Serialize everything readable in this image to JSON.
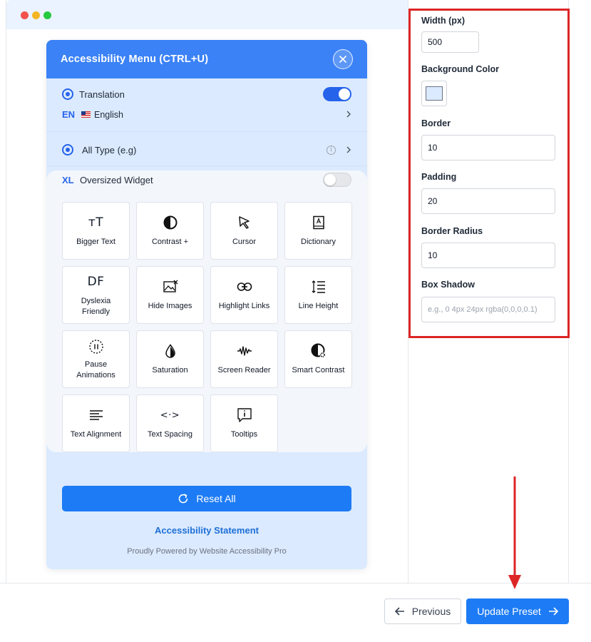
{
  "widget": {
    "title": "Accessibility Menu (CTRL+U)",
    "close_icon": "close-icon",
    "translation": {
      "label": "Translation",
      "enabled": true
    },
    "language": {
      "code": "EN",
      "name": "English",
      "flag_icon": "us-flag-icon"
    },
    "all_type": {
      "label": "All Type (e.g)"
    },
    "oversized": {
      "badge": "XL",
      "label": "Oversized Widget",
      "enabled": false
    },
    "tiles": [
      {
        "label": "Bigger Text",
        "icon": "bigger-text-icon",
        "glyph": "ᴛT"
      },
      {
        "label": "Contrast +",
        "icon": "contrast-icon"
      },
      {
        "label": "Cursor",
        "icon": "cursor-icon"
      },
      {
        "label": "Dictionary",
        "icon": "dictionary-icon"
      },
      {
        "label": "Dyslexia Friendly",
        "icon": "dyslexia-icon",
        "glyph": "DF"
      },
      {
        "label": "Hide Images",
        "icon": "hide-images-icon"
      },
      {
        "label": "Highlight Links",
        "icon": "link-icon"
      },
      {
        "label": "Line Height",
        "icon": "line-height-icon"
      },
      {
        "label": "Pause Animations",
        "icon": "pause-animations-icon"
      },
      {
        "label": "Saturation",
        "icon": "saturation-icon"
      },
      {
        "label": "Screen Reader",
        "icon": "screen-reader-icon"
      },
      {
        "label": "Smart Contrast",
        "icon": "smart-contrast-icon"
      },
      {
        "label": "Text Alignment",
        "icon": "text-align-icon"
      },
      {
        "label": "Text Spacing",
        "icon": "text-spacing-icon",
        "glyph": "<·>"
      },
      {
        "label": "Tooltips",
        "icon": "tooltip-icon"
      }
    ],
    "reset_label": "Reset All",
    "statement_link": "Accessibility Statement",
    "powered_by": "Proudly Powered by Website Accessibility Pro"
  },
  "settings": {
    "width": {
      "label": "Width (px)",
      "value": "500"
    },
    "background_color": {
      "label": "Background Color",
      "value": "#dbeafe"
    },
    "border": {
      "label": "Border",
      "value": "10"
    },
    "padding": {
      "label": "Padding",
      "value": "20"
    },
    "border_radius": {
      "label": "Border Radius",
      "value": "10"
    },
    "box_shadow": {
      "label": "Box Shadow",
      "value": "",
      "placeholder": "e.g., 0 4px 24px rgba(0,0,0,0.1)"
    }
  },
  "footer": {
    "previous_label": "Previous",
    "update_label": "Update Preset"
  },
  "colors": {
    "accent": "#1d7bf5",
    "header_blue": "#3b82f6",
    "highlight_red": "#dc2626"
  }
}
